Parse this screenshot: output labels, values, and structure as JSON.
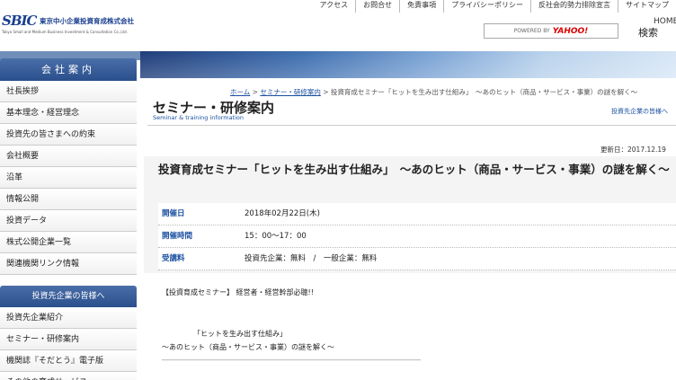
{
  "header": {
    "logo_mark": "SBIC",
    "logo_name": "東京中小企業投資育成株式会社",
    "logo_sub": "Tokyo Small and Medium Business Investment & Consultation Co.,Ltd.",
    "top_nav": [
      "アクセス",
      "お問合せ",
      "免責事項",
      "プライバシーポリシー",
      "反社会的勢力排除宣言",
      "サイトマップ"
    ],
    "search_powered": "POWERED BY",
    "search_brand": "YAHOO!",
    "home_label": "HOME",
    "search_button": "検索"
  },
  "sidebar": {
    "section1_title": "会社案内",
    "items1": [
      "社長挨拶",
      "基本理念・経営理念",
      "投資先の皆さまへの約束",
      "会社概要",
      "沿革",
      "情報公開",
      "投資データ",
      "株式公開企業一覧",
      "関連機関リンク情報"
    ],
    "section2_title": "投資先企業の皆様へ",
    "items2": [
      "投資先企業紹介",
      "セミナー・研修案内",
      "機関誌『そだとう』電子版",
      "その他の育成サービス"
    ]
  },
  "breadcrumb": {
    "home": "ホーム",
    "sep1": " > ",
    "seminar": "セミナー・研修案内",
    "rest": " > 投資育成セミナー「ヒットを生み出す仕組み」　～あのヒット（商品・サービス・事業）の謎を解く～"
  },
  "page": {
    "title": "セミナー・研修案内",
    "subtitle": "Seminar & training information",
    "side_link": "投資先企業の皆様へ",
    "updated": "更新日：2017.12.19"
  },
  "article": {
    "title": "投資育成セミナー「ヒットを生み出す仕組み」　～あのヒット（商品・サービス・事業）の謎を解く～",
    "rows": [
      {
        "label": "開催日",
        "value": "2018年02月22日(木)"
      },
      {
        "label": "開催時間",
        "value": "15：00～17：00"
      },
      {
        "label": "受講料",
        "value": "投資先企業：無料　/　一般企業：無料"
      }
    ],
    "intro": "【投資育成セミナー】 経営者・経営幹部必聴!!",
    "quote_line1": "「ヒットを生み出す仕組み」",
    "quote_line2": "～あのヒット（商品・サービス・事業）の謎を解く～",
    "divider": "――――――――――――――――――――――――――――――――――――"
  }
}
